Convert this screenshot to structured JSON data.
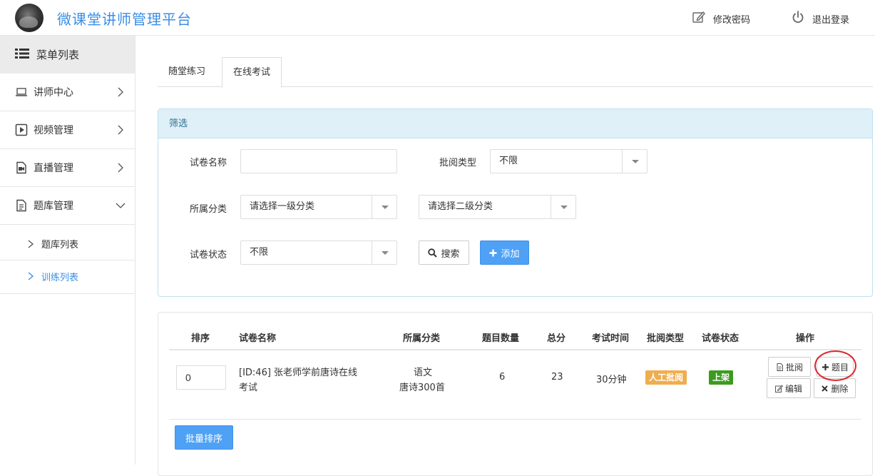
{
  "header": {
    "title": "微课堂讲师管理平台",
    "change_password": "修改密码",
    "logout": "退出登录"
  },
  "sidebar": {
    "menu_title": "菜单列表",
    "items": [
      {
        "label": "讲师中心",
        "icon": "laptop-icon"
      },
      {
        "label": "视频管理",
        "icon": "play-square-icon"
      },
      {
        "label": "直播管理",
        "icon": "video-file-icon"
      },
      {
        "label": "题库管理",
        "icon": "document-icon"
      }
    ],
    "sub_items": [
      {
        "label": "题库列表",
        "active": false
      },
      {
        "label": "训练列表",
        "active": true
      }
    ]
  },
  "tabs": [
    {
      "label": "随堂练习",
      "active": false
    },
    {
      "label": "在线考试",
      "active": true
    }
  ],
  "filter": {
    "title": "筛选",
    "paper_name_label": "试卷名称",
    "paper_name_value": "",
    "review_type_label": "批阅类型",
    "review_type_value": "不限",
    "category_label": "所属分类",
    "category1_value": "请选择一级分类",
    "category2_value": "请选择二级分类",
    "status_label": "试卷状态",
    "status_value": "不限",
    "search_button": "搜索",
    "add_button": "添加"
  },
  "table": {
    "headers": [
      "排序",
      "试卷名称",
      "所属分类",
      "题目数量",
      "总分",
      "考试时间",
      "批阅类型",
      "试卷状态",
      "操作"
    ],
    "rows": [
      {
        "sort": "0",
        "name_line1": "[ID:46] 张老师学前唐诗在线",
        "name_line2": "考试",
        "category_line1": "语文",
        "category_line2": "唐诗300首",
        "question_count": "6",
        "total_score": "23",
        "exam_time": "30分钟",
        "review_type": "人工批阅",
        "status": "上架",
        "actions": {
          "review": "批阅",
          "questions": "题目",
          "edit": "编辑",
          "delete": "删除"
        }
      }
    ],
    "batch_sort_button": "批量排序"
  },
  "colors": {
    "primary": "#4ea1f5",
    "title_blue": "#3a8ee6",
    "label_orange": "#f0ad4e",
    "label_green": "#3c9b1f",
    "highlight_circle": "#e0262c"
  }
}
